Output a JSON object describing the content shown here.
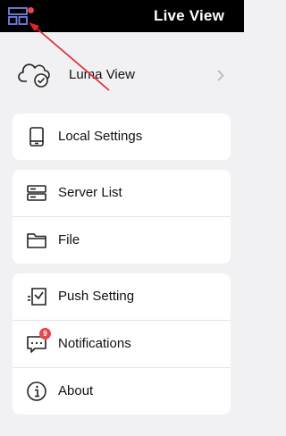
{
  "header": {
    "title": "Live View"
  },
  "cloud": {
    "label": "Luma View"
  },
  "sections": [
    {
      "items": [
        {
          "label": "Local Settings",
          "icon": "tablet-icon"
        }
      ]
    },
    {
      "items": [
        {
          "label": "Server List",
          "icon": "server-icon"
        },
        {
          "label": "File",
          "icon": "folder-icon"
        }
      ]
    },
    {
      "items": [
        {
          "label": "Push Setting",
          "icon": "push-setting-icon"
        },
        {
          "label": "Notifications",
          "icon": "notification-icon",
          "badge": "9"
        },
        {
          "label": "About",
          "icon": "info-icon"
        }
      ]
    }
  ],
  "colors": {
    "badge": "#e5484d",
    "accent_arrow": "#e0252d"
  }
}
